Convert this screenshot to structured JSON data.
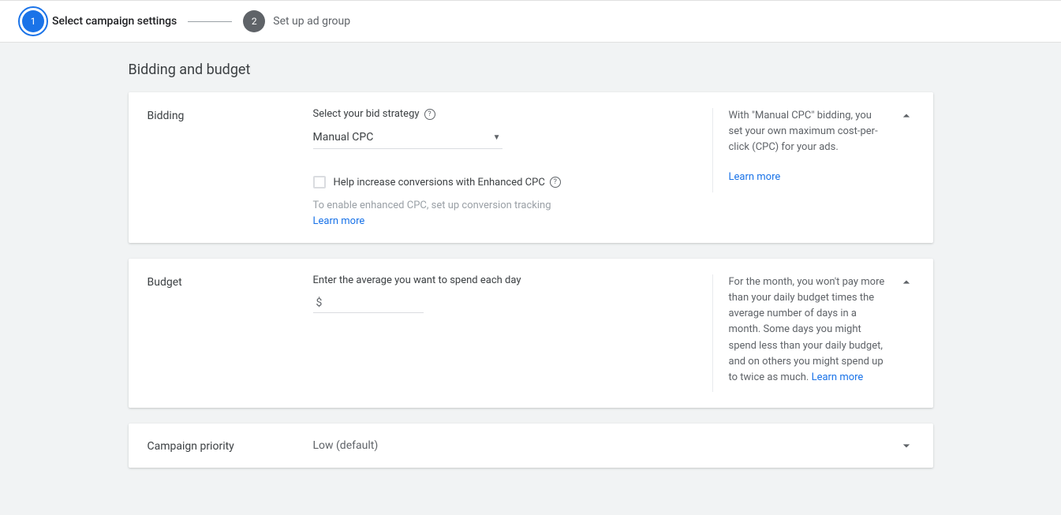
{
  "stepper": {
    "step1": {
      "num": "1",
      "label": "Select campaign settings"
    },
    "step2": {
      "num": "2",
      "label": "Set up ad group"
    }
  },
  "section": {
    "title": "Bidding and budget"
  },
  "bidding": {
    "title": "Bidding",
    "strategy_label": "Select your bid strategy",
    "strategy_value": "Manual CPC",
    "enhanced_checkbox_label": "Help increase conversions with Enhanced CPC",
    "enhanced_hint": "To enable enhanced CPC, set up conversion tracking",
    "learn_more": "Learn more",
    "aside_text": "With \"Manual CPC\" bidding, you set your own maximum cost-per-click (CPC) for your ads.",
    "aside_link": "Learn more"
  },
  "budget": {
    "title": "Budget",
    "label": "Enter the average you want to spend each day",
    "currency": "$",
    "value": "",
    "aside_text": "For the month, you won't pay more than your daily budget times the average number of days in a month. Some days you might spend less than your daily budget, and on others you might spend up to twice as much. ",
    "aside_link": "Learn more"
  },
  "priority": {
    "title": "Campaign priority",
    "value": "Low (default)"
  },
  "glyphs": {
    "help": "?"
  }
}
